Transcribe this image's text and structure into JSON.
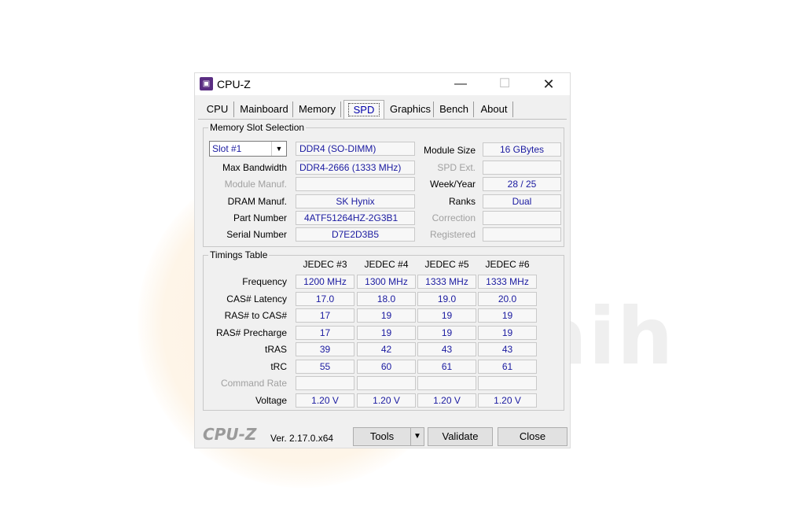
{
  "window": {
    "title": "CPU-Z"
  },
  "tabs": [
    "CPU",
    "Mainboard",
    "Memory",
    "SPD",
    "Graphics",
    "Bench",
    "About"
  ],
  "active_tab": "SPD",
  "memory_slot": {
    "group_title": "Memory Slot Selection",
    "slot_value": "Slot #1",
    "type": "DDR4 (SO-DIMM)",
    "labels": {
      "module_size": "Module Size",
      "max_bandwidth": "Max Bandwidth",
      "spd_ext": "SPD Ext.",
      "module_manuf": "Module Manuf.",
      "week_year": "Week/Year",
      "dram_manuf": "DRAM Manuf.",
      "ranks": "Ranks",
      "part_number": "Part Number",
      "correction": "Correction",
      "serial_number": "Serial Number",
      "registered": "Registered"
    },
    "values": {
      "module_size": "16 GBytes",
      "max_bandwidth": "DDR4-2666 (1333 MHz)",
      "spd_ext": "",
      "module_manuf": "",
      "week_year": "28 / 25",
      "dram_manuf": "SK Hynix",
      "ranks": "Dual",
      "part_number": "4ATF51264HZ-2G3B1",
      "correction": "",
      "serial_number": "D7E2D3B5",
      "registered": ""
    }
  },
  "timings": {
    "group_title": "Timings Table",
    "columns": [
      "JEDEC #3",
      "JEDEC #4",
      "JEDEC #5",
      "JEDEC #6"
    ],
    "rows": [
      {
        "label": "Frequency",
        "values": [
          "1200 MHz",
          "1300 MHz",
          "1333 MHz",
          "1333 MHz"
        ]
      },
      {
        "label": "CAS# Latency",
        "values": [
          "17.0",
          "18.0",
          "19.0",
          "20.0"
        ]
      },
      {
        "label": "RAS# to CAS#",
        "values": [
          "17",
          "19",
          "19",
          "19"
        ]
      },
      {
        "label": "RAS# Precharge",
        "values": [
          "17",
          "19",
          "19",
          "19"
        ]
      },
      {
        "label": "tRAS",
        "values": [
          "39",
          "42",
          "43",
          "43"
        ]
      },
      {
        "label": "tRC",
        "values": [
          "55",
          "60",
          "61",
          "61"
        ]
      },
      {
        "label": "Command Rate",
        "values": [
          "",
          "",
          "",
          ""
        ]
      },
      {
        "label": "Voltage",
        "values": [
          "1.20 V",
          "1.20 V",
          "1.20 V",
          "1.20 V"
        ]
      }
    ]
  },
  "footer": {
    "logo": "CPU-Z",
    "version": "Ver. 2.17.0.x64",
    "tools_label": "Tools",
    "validate_label": "Validate",
    "close_label": "Close"
  },
  "watermark": {
    "text": "umaih"
  }
}
